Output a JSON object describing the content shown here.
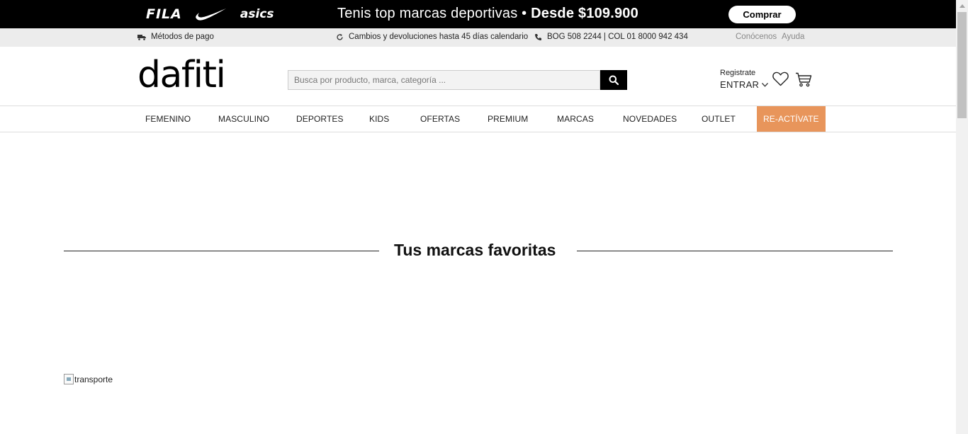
{
  "promo": {
    "brands": [
      "FILA",
      "NIKE",
      "asics"
    ],
    "text_main": "Tenis top marcas deportivas •",
    "text_price": "Desde $109.900",
    "button_label": "Comprar"
  },
  "infobar": {
    "payment": "Métodos de pago",
    "returns": "Cambios y devoluciones hasta 45 días calendario",
    "phone": "BOG 508 2244 | COL 01 8000 942 434",
    "about": "Conócenos",
    "help": "Ayuda"
  },
  "header": {
    "logo": "dafiti",
    "search_placeholder": "Busca por producto, marca, categoría ...",
    "registrate": "Registrate",
    "entrar": "ENTRAR"
  },
  "nav": {
    "items": [
      "FEMENINO",
      "MASCULINO",
      "DEPORTES",
      "KIDS",
      "OFERTAS",
      "PREMIUM",
      "MARCAS",
      "NOVEDADES",
      "OUTLET",
      "RE-ACTÍVATE"
    ]
  },
  "main": {
    "section_title": "Tus marcas favoritas",
    "broken_image_alt": "transporte"
  },
  "colors": {
    "promo_bg": "#000000",
    "accent": "#e8955b",
    "infobar_bg": "#ececec"
  }
}
